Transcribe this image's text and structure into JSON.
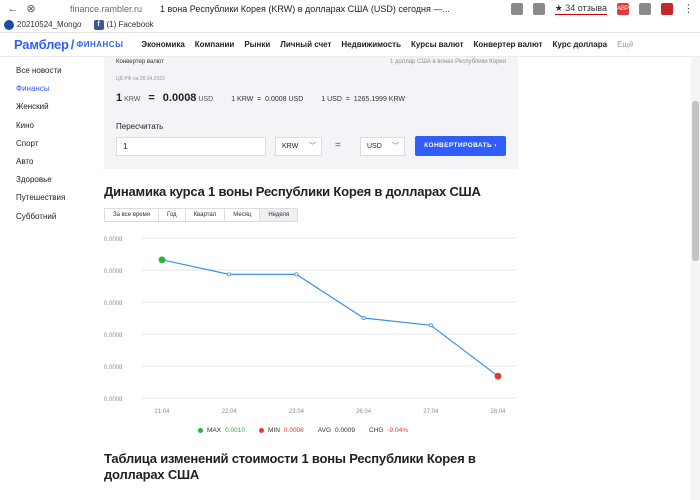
{
  "browser": {
    "url": "finance.rambler.ru",
    "title": "1 вона Республики Корея (KRW) в долларах США (USD) сегодня —...",
    "reviews": "★ 34 отзыва",
    "ext_badge": "ABP"
  },
  "bookmarks": [
    {
      "label": "20210524_Mongo"
    },
    {
      "label": "(1) Facebook"
    }
  ],
  "header": {
    "logo_main": "Рамблер",
    "logo_sub": "ФИНАНСЫ",
    "nav": [
      "Экономика",
      "Компании",
      "Рынки",
      "Личный счет",
      "Недвижимость",
      "Курсы валют",
      "Конвертер валют",
      "Курс доллара",
      "Ещё"
    ]
  },
  "sidebar": {
    "items": [
      "Все новости",
      "Финансы",
      "Женский",
      "Кино",
      "Спорт",
      "Авто",
      "Здоровье",
      "Путешествия",
      "Субботний"
    ],
    "active_index": 1
  },
  "converter": {
    "title": "Конвертер валют",
    "title_right": "1 доллар США в вонах Республики Корея",
    "cb_date": "ЦБ РФ на 28.04.2022",
    "main_amount": "1",
    "main_from": "KRW",
    "main_result": "0.0008",
    "main_to": "USD",
    "rate1": "1 KRW  =  0.0008 USD",
    "rate2": "1 USD  =  1265.1999 KRW",
    "recalc_label": "Пересчитать",
    "amount_value": "1",
    "from_currency": "KRW",
    "to_currency": "USD",
    "button_label": "КОНВЕРТИРОВАТЬ ›"
  },
  "chart_section": {
    "heading": "Динамика курса 1 воны Республики Корея в долларах США",
    "periods": [
      "За все время",
      "Год",
      "Квартал",
      "Месяц",
      "Неделя"
    ],
    "active_period": 4
  },
  "chart_data": {
    "type": "line",
    "x": [
      "21.04",
      "22.04",
      "23.04",
      "26.04",
      "27.04",
      "28.04"
    ],
    "series": [
      {
        "values": [
          0.000806,
          0.000804,
          0.000804,
          0.000798,
          0.000797,
          0.00079
        ]
      }
    ],
    "ylim": [
      0.000787,
      0.000809
    ],
    "yticks": [
      "0.0008",
      "0.0008",
      "0.0008",
      "0.0008",
      "0.0008",
      "0.0008"
    ],
    "max_index": 0,
    "min_index": 5,
    "colors": {
      "line": "#3d8fe6",
      "max": "#2bb234",
      "min": "#e53935",
      "grid": "#e3e5ea"
    }
  },
  "stats": {
    "max_label": "MAX",
    "max_value": "0.0010",
    "min_label": "MIN",
    "min_value": "0.0008",
    "avg_label": "AVG",
    "avg_value": "0.0009",
    "chg_label": "CHG",
    "chg_value": "-9.04%"
  },
  "table_section": {
    "heading": "Таблица изменений стоимости 1 воны Республики Корея в долларах США"
  }
}
